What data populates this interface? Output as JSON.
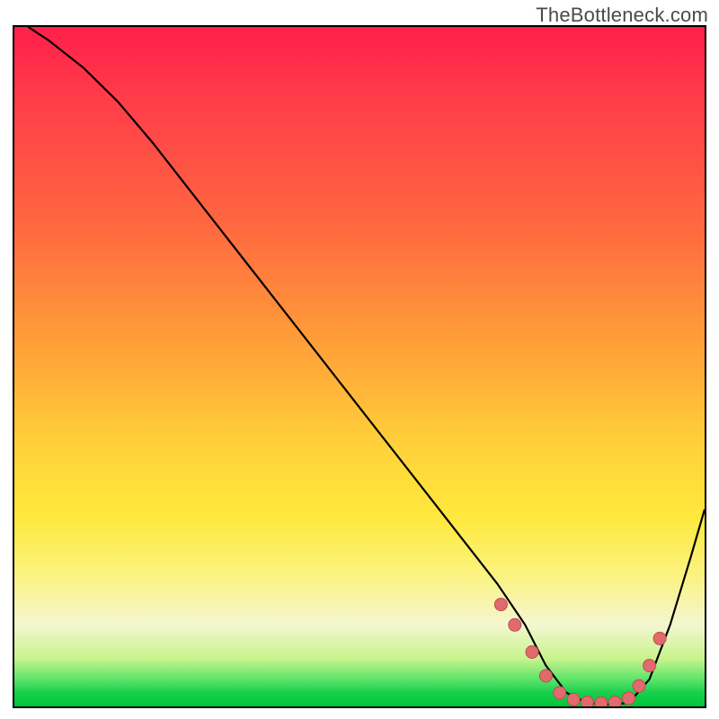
{
  "watermark": "TheBottleneck.com",
  "colors": {
    "gradient_top": "#ff1f4b",
    "gradient_mid1": "#ff6a3f",
    "gradient_mid2": "#ffd23a",
    "gradient_bottom": "#00c637",
    "curve": "#000000",
    "dot_fill": "#e06a6e",
    "dot_stroke": "#c14c50",
    "frame": "#000000"
  },
  "chart_data": {
    "type": "line",
    "title": "",
    "xlabel": "",
    "ylabel": "",
    "xlim": [
      0,
      100
    ],
    "ylim": [
      0,
      100
    ],
    "note": "Curve is a V-shape descending from top-left to a flat bottom around x≈78–90 then rising toward top-right. Salmon dots mark the flat-bottom region. No axis tick labels are rendered; values below are estimated from pixel positions on a 0–100 normalized grid.",
    "series": [
      {
        "name": "curve",
        "x": [
          2,
          5,
          10,
          15,
          20,
          30,
          40,
          50,
          60,
          70,
          74,
          77,
          80,
          83,
          86,
          89,
          92,
          95,
          98,
          100
        ],
        "values": [
          100,
          98,
          94,
          89,
          83,
          70,
          57,
          44,
          31,
          18,
          12,
          6,
          2,
          0.5,
          0.3,
          0.5,
          4,
          12,
          22,
          29
        ]
      }
    ],
    "points": {
      "name": "highlight-dots",
      "x": [
        70.5,
        72.5,
        75.0,
        77.0,
        79.0,
        81.0,
        83.0,
        85.0,
        87.0,
        89.0,
        90.5,
        92.0,
        93.5
      ],
      "values": [
        15.0,
        12.0,
        8.0,
        4.5,
        2.0,
        1.0,
        0.6,
        0.5,
        0.6,
        1.2,
        3.0,
        6.0,
        10.0
      ]
    }
  }
}
